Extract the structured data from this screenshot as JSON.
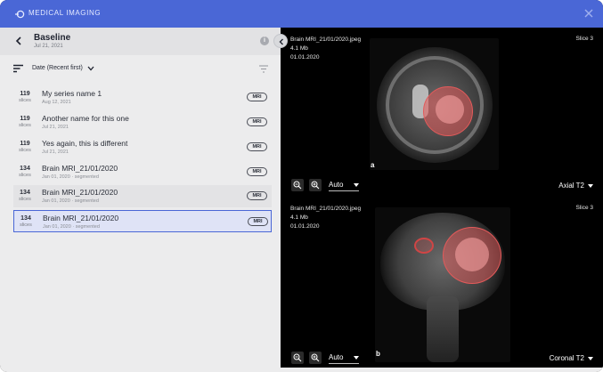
{
  "app": {
    "title": "MEDICAL IMAGING",
    "accent": "#4a67d6"
  },
  "study": {
    "title": "Baseline",
    "date": "Jul 21, 2021"
  },
  "sort": {
    "label": "Date (Recent first)"
  },
  "series": [
    {
      "count": "119",
      "unit": "slices",
      "name": "My series name 1",
      "meta": "Aug 12, 2021",
      "modality": "MRI"
    },
    {
      "count": "119",
      "unit": "slices",
      "name": "Another name for this one",
      "meta": "Jul 21, 2021",
      "modality": "MRI"
    },
    {
      "count": "119",
      "unit": "slices",
      "name": "Yes again, this is different",
      "meta": "Jul 21, 2021",
      "modality": "MRI"
    },
    {
      "count": "134",
      "unit": "slices",
      "name": "Brain MRI_21/01/2020",
      "meta": "Jan 01, 2020 · segmented",
      "modality": "MRI"
    },
    {
      "count": "134",
      "unit": "slices",
      "name": "Brain MRI_21/01/2020",
      "meta": "Jan 01, 2020 · segmented",
      "modality": "MRI"
    },
    {
      "count": "134",
      "unit": "slices",
      "name": "Brain MRI_21/01/2020",
      "meta": "Jan 01, 2020 · segmented",
      "modality": "MRI"
    }
  ],
  "viewers": [
    {
      "file": "Brain MRI_21/01/2020.jpeg",
      "size": "4.1 Mb",
      "date": "01.01.2020",
      "slice": "Slice 3",
      "zoom": "Auto",
      "plane": "Axial T2",
      "tag": "a"
    },
    {
      "file": "Brain MRI_21/01/2020.jpeg",
      "size": "4.1 Mb",
      "date": "01.01.2020",
      "slice": "Slice 3",
      "zoom": "Auto",
      "plane": "Coronal T2",
      "tag": "b"
    }
  ],
  "icons": {
    "logo": "logo-icon",
    "close": "close-icon",
    "back": "chevron-left-icon",
    "info": "info-icon",
    "collapse": "chevron-left-icon",
    "sort": "sort-icon",
    "sort_toggle": "chevron-down-icon",
    "filter": "filter-icon",
    "zoom_out": "zoom-out-icon",
    "zoom_in": "zoom-in-icon"
  },
  "segmentation_color": "#e35a5a"
}
